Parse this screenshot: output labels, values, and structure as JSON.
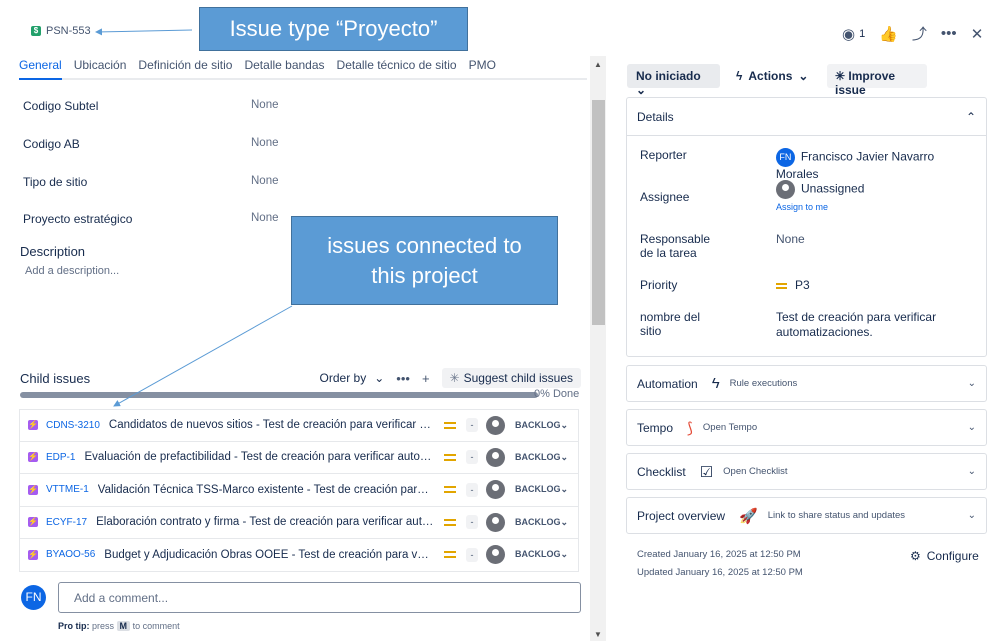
{
  "issue": {
    "key": "PSN-553",
    "key_icon": "$"
  },
  "tabs": [
    "General",
    "Ubicación",
    "Definición de sitio",
    "Detalle bandas",
    "Detalle técnico de sitio",
    "PMO"
  ],
  "fields": [
    {
      "label": "Codigo Subtel",
      "value": "None"
    },
    {
      "label": "Codigo AB",
      "value": "None"
    },
    {
      "label": "Tipo de sitio",
      "value": "None"
    },
    {
      "label": "Proyecto estratégico",
      "value": "None"
    }
  ],
  "description": {
    "title": "Description",
    "placeholder": "Add a description..."
  },
  "child_issues": {
    "title": "Child issues",
    "order_by": "Order by",
    "suggest_label": "Suggest child issues",
    "progress_label": "0% Done",
    "progress": 0,
    "items": [
      {
        "key": "CDNS-3210",
        "summary": "Candidatos de nuevos sitios - Test de creación para verificar automatizaciones.",
        "status": "BACKLOG"
      },
      {
        "key": "EDP-1",
        "summary": "Evaluación de prefactibilidad - Test de creación para verificar automatizaciones.",
        "status": "BACKLOG"
      },
      {
        "key": "VTTME-1",
        "summary": "Validación Técnica TSS-Marco existente - Test de creación para verificar automatizaciones.",
        "status": "BACKLOG"
      },
      {
        "key": "ECYF-17",
        "summary": "Elaboración contrato y firma - Test de creación para verificar automatizaciones.",
        "status": "BACKLOG"
      },
      {
        "key": "BYAOO-56",
        "summary": "Budget y Adjudicación Obras OOEE - Test de creación para verificar automatizaciones.",
        "status": "BACKLOG"
      }
    ]
  },
  "comment": {
    "avatar_initials": "FN",
    "placeholder": "Add a comment...",
    "pro_tip_label": "Pro tip:",
    "pro_tip_press": "press",
    "pro_tip_key": "M",
    "pro_tip_rest": "to comment"
  },
  "callouts": {
    "issue_type": "Issue type “Proyecto”",
    "connected": "issues connected to\nthis project"
  },
  "header": {
    "watch_count": "1"
  },
  "status_button": "No iniciado",
  "actions_button": "Actions",
  "improve_button": "Improve issue",
  "details": {
    "title": "Details",
    "reporter_label": "Reporter",
    "reporter_initials": "FN",
    "reporter_name": "Francisco Javier Navarro Morales",
    "assignee_label": "Assignee",
    "assignee_value": "Unassigned",
    "assign_link": "Assign to me",
    "responsable_label": "Responsable de la tarea",
    "responsable_value": "None",
    "priority_label": "Priority",
    "priority_value": "P3",
    "nombre_label": "nombre del sitio",
    "nombre_value": "Test de creación para verificar automatizaciones."
  },
  "panels": [
    {
      "title": "Automation",
      "icon": "lightning-icon",
      "sub": "Rule executions"
    },
    {
      "title": "Tempo",
      "icon": "tempo-icon",
      "sub": "Open Tempo"
    },
    {
      "title": "Checklist",
      "icon": "checkbox-icon",
      "sub": "Open Checklist"
    },
    {
      "title": "Project overview",
      "icon": "rocket-icon",
      "sub": "Link to share status and updates"
    }
  ],
  "meta": {
    "created": "Created January 16, 2025 at 12:50 PM",
    "updated": "Updated January 16, 2025 at 12:50 PM"
  },
  "configure_label": "Configure",
  "colors": {
    "accent": "#0c66e4",
    "callout": "#5b9bd5",
    "priority": "#e2a500",
    "subtask": "#a55cf0",
    "key_icon": "#22a06b"
  }
}
